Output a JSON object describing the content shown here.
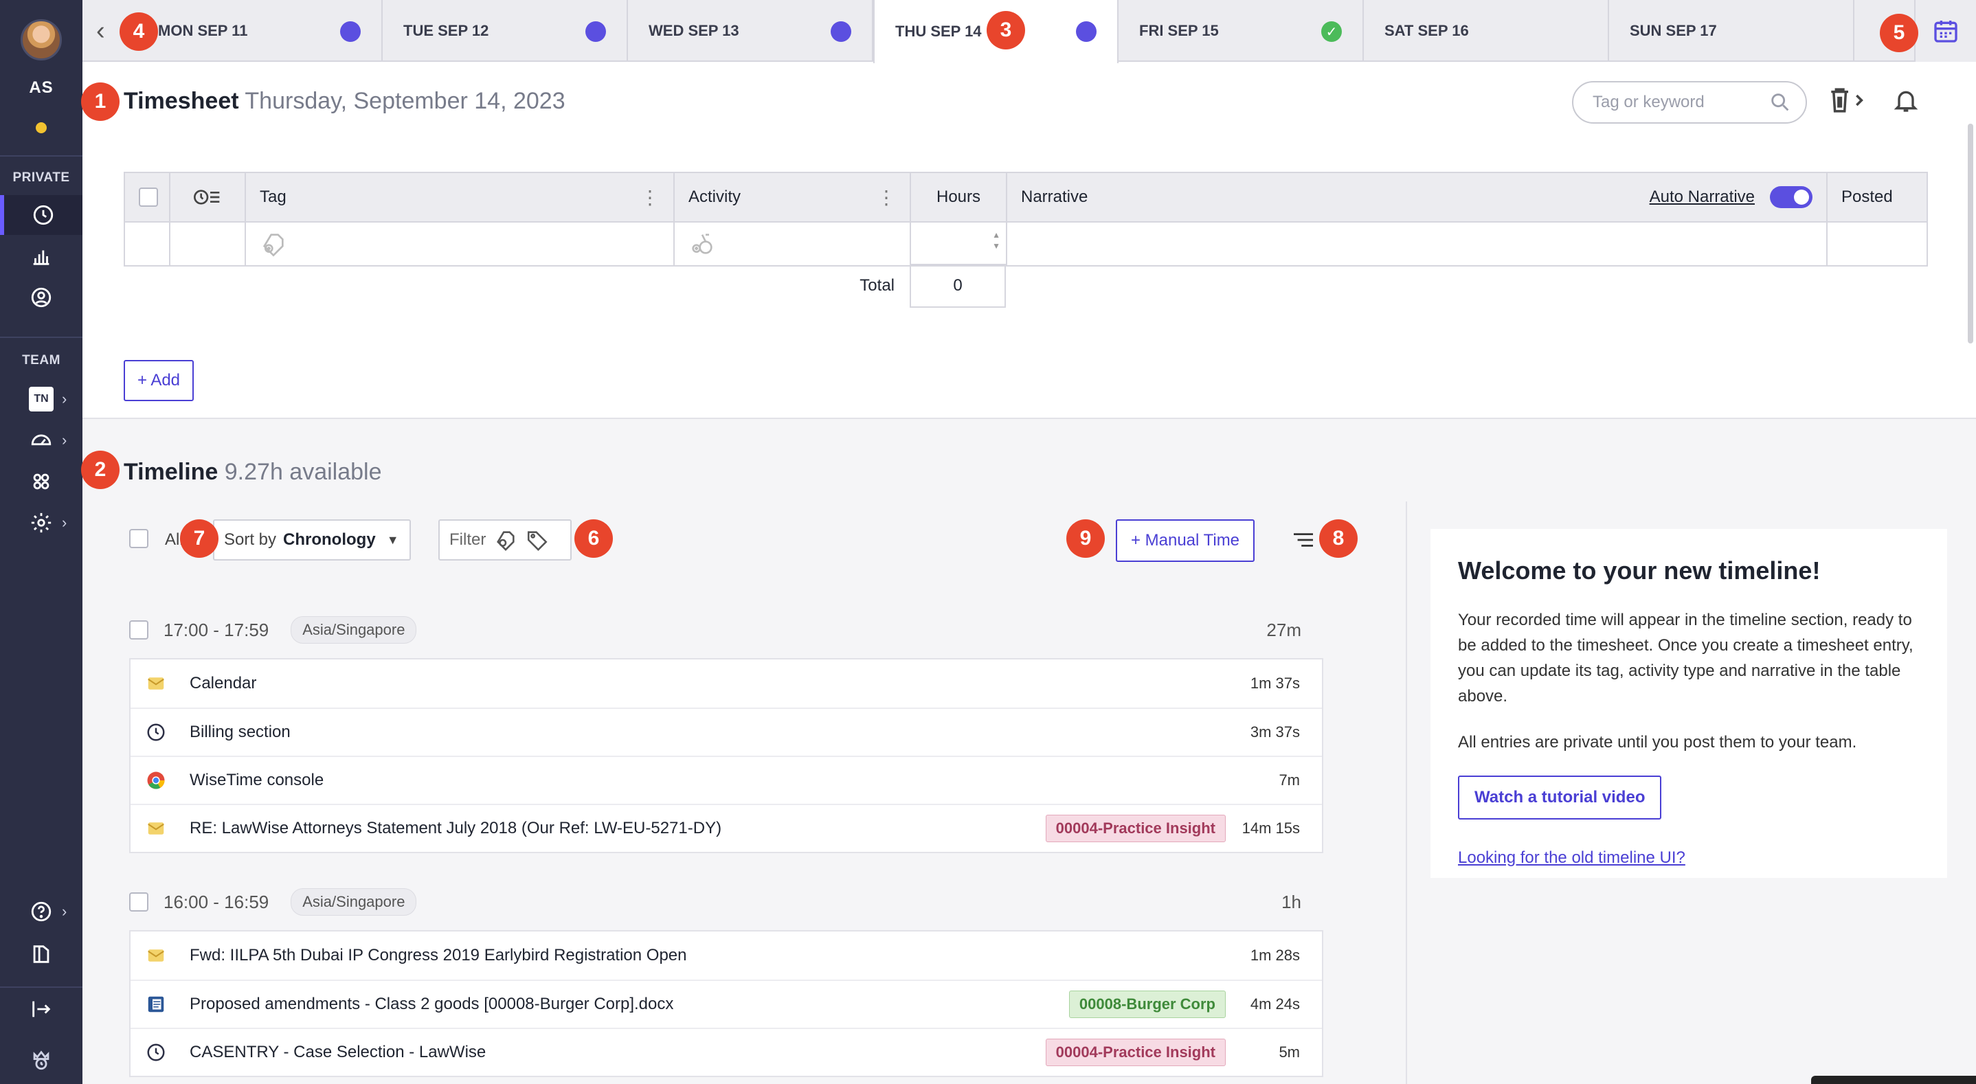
{
  "user": {
    "initials": "AS"
  },
  "sidebar": {
    "private_label": "PRIVATE",
    "team_label": "TEAM",
    "team_badge": "TN"
  },
  "days": [
    {
      "label": "MON SEP 11",
      "status": "pending"
    },
    {
      "label": "TUE SEP 12",
      "status": "pending"
    },
    {
      "label": "WED SEP 13",
      "status": "pending"
    },
    {
      "label": "THU SEP 14",
      "status": "pending"
    },
    {
      "label": "FRI SEP 15",
      "status": "done"
    },
    {
      "label": "SAT SEP 16",
      "status": "none"
    },
    {
      "label": "SUN SEP 17",
      "status": "none"
    }
  ],
  "timesheet": {
    "title": "Timesheet",
    "date": "Thursday, September 14, 2023",
    "search_placeholder": "Tag or keyword",
    "columns": {
      "tag": "Tag",
      "activity": "Activity",
      "hours": "Hours",
      "narrative": "Narrative",
      "auto_narrative": "Auto Narrative",
      "posted": "Posted"
    },
    "total_label": "Total",
    "total_value": "0",
    "add_label": "+ Add"
  },
  "timeline": {
    "title": "Timeline",
    "available": "9.27h available",
    "all_label": "All",
    "sort_prefix": "Sort by",
    "sort_value": "Chronology",
    "filter_label": "Filter",
    "manual_label": "+ Manual Time",
    "groups": [
      {
        "range": "17:00 - 17:59",
        "tz": "Asia/Singapore",
        "total": "27m",
        "entries": [
          {
            "icon": "outlook-icon",
            "title": "Calendar",
            "tag": "",
            "duration": "1m 37s"
          },
          {
            "icon": "clock-icon",
            "title": "Billing section",
            "tag": "",
            "duration": "3m 37s"
          },
          {
            "icon": "chrome-icon",
            "title": "WiseTime console",
            "tag": "",
            "duration": "7m"
          },
          {
            "icon": "outlook-icon",
            "title": "RE: LawWise Attorneys Statement July 2018 (Our Ref: LW-EU-5271-DY)",
            "tag": "00004-Practice Insight",
            "duration": "14m 15s"
          }
        ]
      },
      {
        "range": "16:00 - 16:59",
        "tz": "Asia/Singapore",
        "total": "1h",
        "entries": [
          {
            "icon": "outlook-icon",
            "title": "Fwd: IILPA 5th Dubai IP Congress 2019 Earlybird Registration Open",
            "tag": "",
            "duration": "1m 28s"
          },
          {
            "icon": "word-icon",
            "title": "Proposed amendments - Class 2 goods [00008-Burger Corp].docx",
            "tag": "00008-Burger Corp",
            "duration": "4m 24s"
          },
          {
            "icon": "clock-icon",
            "title": "CASENTRY - Case Selection - LawWise",
            "tag": "00004-Practice Insight",
            "duration": "5m"
          }
        ]
      }
    ]
  },
  "welcome": {
    "title": "Welcome to your new timeline!",
    "body1": "Your recorded time will appear in the timeline section, ready to be added to the timesheet. Once you create a timesheet entry, you can update its tag, activity type and narrative in the table above.",
    "body2": "All entries are private until you post them to your team.",
    "tutorial_label": "Watch a tutorial video",
    "old_link": "Looking for the old timeline UI?"
  },
  "annotations": [
    "1",
    "2",
    "3",
    "4",
    "5",
    "6",
    "7",
    "8",
    "9"
  ],
  "colors": {
    "accent": "#5b4fe0",
    "sidebar": "#2c2f45",
    "annotation": "#e8452c",
    "done": "#4cbb5a"
  }
}
